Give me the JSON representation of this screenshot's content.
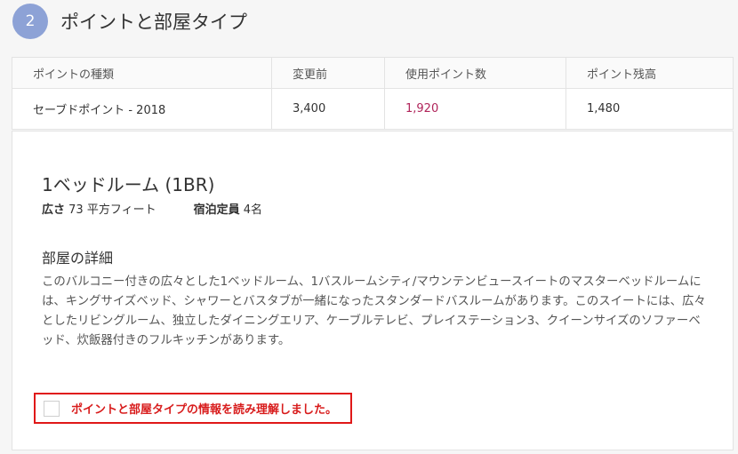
{
  "step": {
    "number": "2",
    "title": "ポイントと部屋タイプ"
  },
  "points_table": {
    "headers": [
      "ポイントの種類",
      "変更前",
      "使用ポイント数",
      "ポイント残高"
    ],
    "row": {
      "type": "セーブドポイント - 2018",
      "before": "3,400",
      "used": "1,920",
      "balance": "1,480"
    }
  },
  "room": {
    "name": "1ベッドルーム (1BR)",
    "size_label": "広さ",
    "size_value": "73 平方フィート",
    "capacity_label": "宿泊定員",
    "capacity_value": "4名",
    "details_heading": "部屋の詳細",
    "details_text": "このバルコニー付きの広々とした1ベッドルーム、1バスルームシティ/マウンテンビュースイートのマスターベッドルームには、キングサイズベッド、シャワーとバスタブが一緒になったスタンダードバスルームがあります。このスイートには、広々としたリビングルーム、独立したダイニングエリア、ケーブルテレビ、プレイステーション3、クイーンサイズのソファーベッド、炊飯器付きのフルキッチンがあります。"
  },
  "confirm": {
    "label": "ポイントと部屋タイプの情報を読み理解しました。",
    "checked": false
  },
  "colors": {
    "accent": "#8da2d6",
    "used_points": "#b0245a",
    "warning": "#e01818"
  }
}
